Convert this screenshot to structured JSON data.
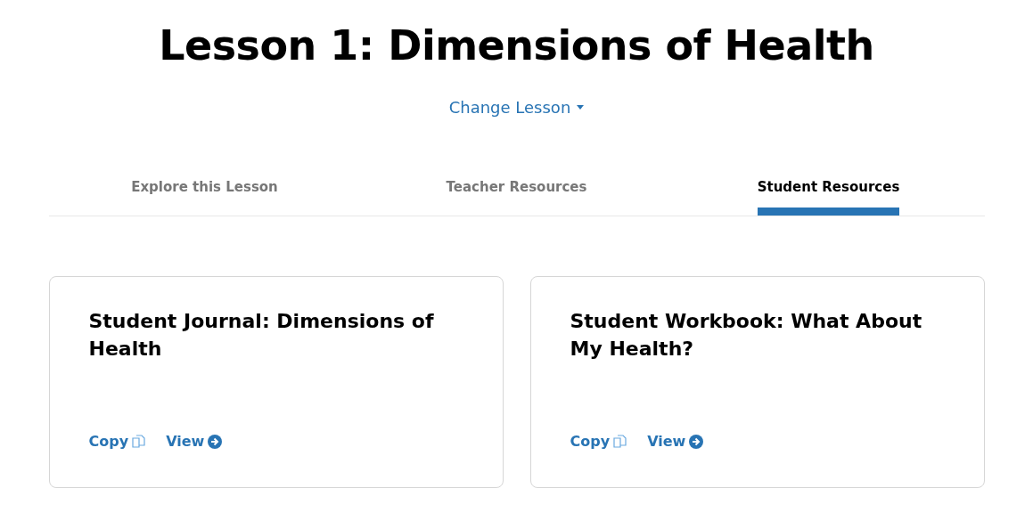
{
  "title": "Lesson 1: Dimensions of Health",
  "change_lesson": "Change Lesson",
  "tabs": [
    {
      "label": "Explore this Lesson",
      "selected": false
    },
    {
      "label": "Teacher Resources",
      "selected": false
    },
    {
      "label": "Student Resources",
      "selected": true
    }
  ],
  "cards": [
    {
      "title": "Student Journal: Dimensions of Health",
      "copy": "Copy",
      "view": "View"
    },
    {
      "title": "Student Workbook: What About My Health?",
      "copy": "Copy",
      "view": "View"
    }
  ]
}
